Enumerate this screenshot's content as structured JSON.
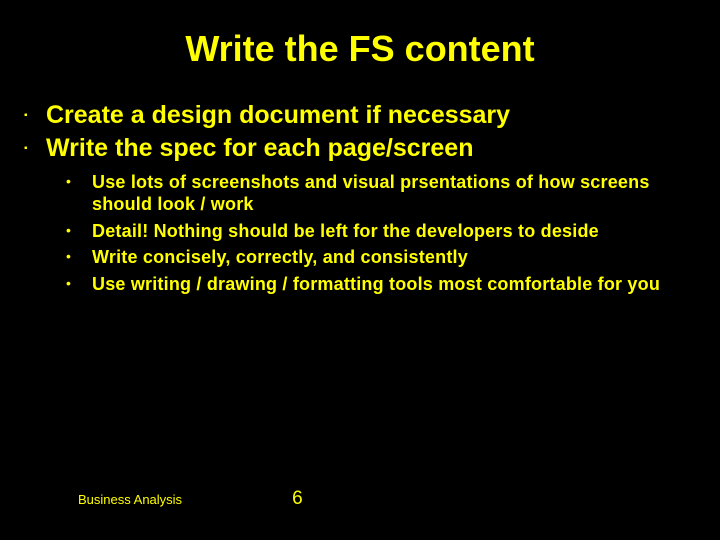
{
  "title": "Write the FS content",
  "main_items": [
    "Create a design document if necessary",
    "Write the spec for each page/screen"
  ],
  "sub_items": [
    "Use lots of screenshots and visual prsentations of how screens should look / work",
    "Detail! Nothing should be left for the developers to deside",
    "Write concisely, correctly, and consistently",
    "Use writing / drawing / formatting tools most comfortable for you"
  ],
  "footer": {
    "label": "Business Analysis",
    "page": "6"
  }
}
